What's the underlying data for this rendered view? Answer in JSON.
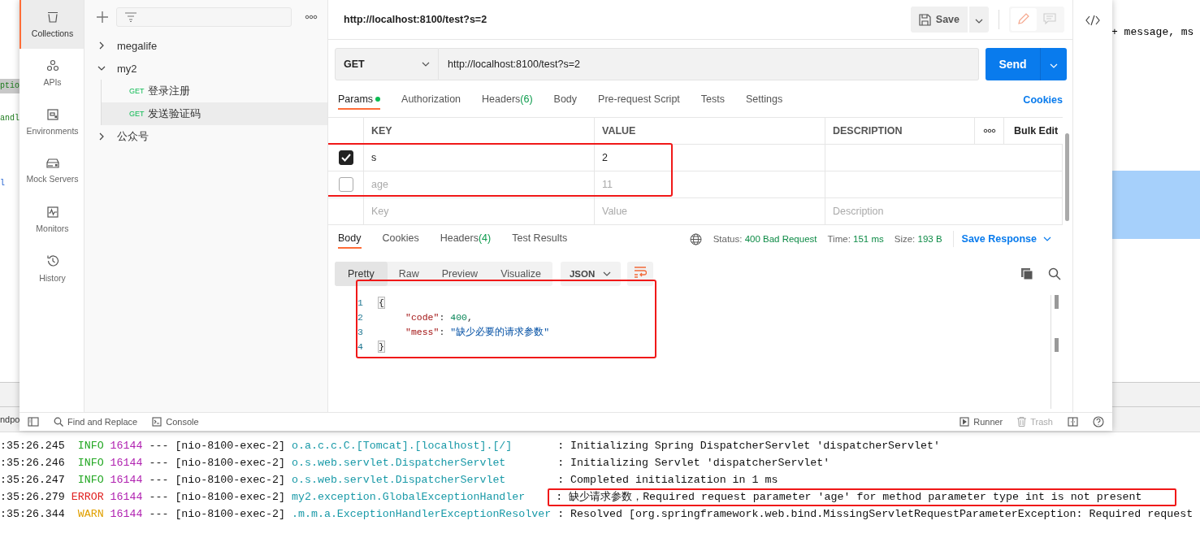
{
  "ide": {
    "left_fragments": [
      {
        "text": "ptio",
        "selected": true
      },
      {
        "text": "andl",
        "selected": false
      },
      {
        "text": "l",
        "selected": false
      }
    ],
    "right_fragment": "+ message, ms",
    "tab_fragment": "ndpo",
    "log_lines": [
      {
        "time": ":35:26.245",
        "severity": "INFO",
        "color": "#22a722",
        "pid": "16144",
        "sep": "---",
        "thread": "[nio-8100-exec-2]",
        "logger": "o.a.c.c.C.[Tomcat].[localhost].[/]",
        "message": ": Initializing Spring DispatcherServlet 'dispatcherServlet'",
        "highlight": false
      },
      {
        "time": ":35:26.246",
        "severity": "INFO",
        "color": "#22a722",
        "pid": "16144",
        "sep": "---",
        "thread": "[nio-8100-exec-2]",
        "logger": "o.s.web.servlet.DispatcherServlet",
        "message": ": Initializing Servlet 'dispatcherServlet'",
        "highlight": false
      },
      {
        "time": ":35:26.247",
        "severity": "INFO",
        "color": "#22a722",
        "pid": "16144",
        "sep": "---",
        "thread": "[nio-8100-exec-2]",
        "logger": "o.s.web.servlet.DispatcherServlet",
        "message": ": Completed initialization in 1 ms",
        "highlight": false
      },
      {
        "time": ":35:26.279",
        "severity": "ERROR",
        "color": "#e02020",
        "pid": "16144",
        "sep": "---",
        "thread": "[nio-8100-exec-2]",
        "logger": "my2.exception.GlobalExceptionHandler",
        "message": ": 缺少请求参数，Required request parameter 'age' for method parameter type int is not present",
        "highlight": true
      },
      {
        "time": ":35:26.344",
        "severity": "WARN",
        "color": "#e0a000",
        "pid": "16144",
        "sep": "---",
        "thread": "[nio-8100-exec-2]",
        "logger": ".m.m.a.ExceptionHandlerExceptionResolver",
        "message": ": Resolved [org.springframework.web.bind.MissingServletRequestParameterException: Required request",
        "highlight": false
      }
    ]
  },
  "postman": {
    "nav": [
      {
        "label": "Collections",
        "selected": true
      },
      {
        "label": "APIs",
        "selected": false
      },
      {
        "label": "Environments",
        "selected": false
      },
      {
        "label": "Mock Servers",
        "selected": false
      },
      {
        "label": "Monitors",
        "selected": false
      },
      {
        "label": "History",
        "selected": false
      }
    ],
    "tree": [
      {
        "name": "megalife",
        "expanded": false,
        "selected": false
      },
      {
        "name": "my2",
        "expanded": true,
        "selected": false,
        "children": [
          {
            "method": "GET",
            "name": "登录注册",
            "selected": false
          },
          {
            "method": "GET",
            "name": "发送验证码",
            "selected": true
          }
        ]
      },
      {
        "name": "公众号",
        "expanded": false,
        "selected": false
      }
    ],
    "request_title": "http://localhost:8100/test?s=2",
    "save_label": "Save",
    "method": "GET",
    "url": "http://localhost:8100/test?s=2",
    "send_label": "Send",
    "request_tabs": [
      {
        "label": "Params",
        "selected": true,
        "has_content": true
      },
      {
        "label": "Authorization",
        "selected": false,
        "has_content": false
      },
      {
        "label": "Headers",
        "count": "(6)",
        "selected": false,
        "has_content": false
      },
      {
        "label": "Body",
        "selected": false,
        "has_content": false
      },
      {
        "label": "Pre-request Script",
        "selected": false,
        "has_content": false
      },
      {
        "label": "Tests",
        "selected": false,
        "has_content": false
      },
      {
        "label": "Settings",
        "selected": false,
        "has_content": false
      }
    ],
    "cookies_link": "Cookies",
    "params": {
      "highlight": true,
      "columns": [
        "KEY",
        "VALUE",
        "DESCRIPTION"
      ],
      "bulk_edit": "Bulk Edit",
      "rows": [
        {
          "checked": true,
          "key": "s",
          "value": "2"
        },
        {
          "checked": false,
          "key": "age",
          "value": "11"
        }
      ],
      "new_row": {
        "key": {
          "placeholder": "Key"
        },
        "value": {
          "placeholder": "Value"
        },
        "description": {
          "placeholder": "Description"
        }
      }
    },
    "response_tabs": [
      {
        "label": "Body",
        "selected": true
      },
      {
        "label": "Cookies",
        "selected": false
      },
      {
        "label": "Headers",
        "count": "(4)",
        "selected": false
      },
      {
        "label": "Test Results",
        "selected": false
      }
    ],
    "status": [
      {
        "label": "Status:",
        "value": "400 Bad Request"
      },
      {
        "label": "Time:",
        "value": "151 ms"
      },
      {
        "label": "Size:",
        "value": "193 B"
      }
    ],
    "save_response": "Save Response",
    "view_modes": [
      {
        "label": "Pretty",
        "selected": true
      },
      {
        "label": "Raw",
        "selected": false
      },
      {
        "label": "Preview",
        "selected": false
      },
      {
        "label": "Visualize",
        "selected": false
      }
    ],
    "format": "JSON",
    "body": {
      "highlight": true,
      "lines": [
        {
          "number": "1",
          "tokens": [
            {
              "kind": "brace",
              "text": "{"
            }
          ]
        },
        {
          "number": "2",
          "tokens": [
            {
              "kind": "key",
              "text": "\"code\""
            },
            {
              "kind": "punct",
              "text": ": "
            },
            {
              "kind": "number",
              "text": "400"
            },
            {
              "kind": "punct",
              "text": ","
            }
          ]
        },
        {
          "number": "3",
          "tokens": [
            {
              "kind": "key",
              "text": "\"mess\""
            },
            {
              "kind": "punct",
              "text": ": "
            },
            {
              "kind": "string",
              "text": "\"缺少必要的请求参数\""
            }
          ]
        },
        {
          "number": "4",
          "tokens": [
            {
              "kind": "brace",
              "text": "}"
            }
          ]
        }
      ]
    },
    "footer": {
      "find": "Find and Replace",
      "console": "Console",
      "runner": "Runner",
      "trash": {
        "label": "Trash",
        "disabled": true
      }
    }
  }
}
